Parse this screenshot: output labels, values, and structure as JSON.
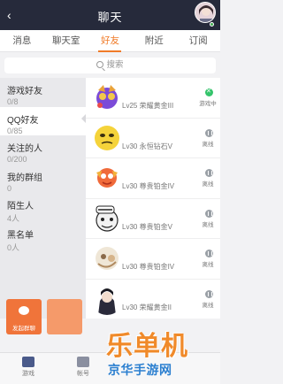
{
  "header": {
    "title": "聊天",
    "back_glyph": "‹"
  },
  "tabs": [
    {
      "label": "消息"
    },
    {
      "label": "聊天室"
    },
    {
      "label": "好友",
      "active": true
    },
    {
      "label": "附近"
    },
    {
      "label": "订阅"
    }
  ],
  "search": {
    "placeholder": "搜索"
  },
  "categories": [
    {
      "name": "游戏好友",
      "count": "0/8"
    },
    {
      "name": "QQ好友",
      "count": "0/85",
      "active": true
    },
    {
      "name": "关注的人",
      "count": "0/200"
    },
    {
      "name": "我的群组",
      "count": "0"
    },
    {
      "name": "陌生人",
      "count": "4人"
    },
    {
      "name": "黑名单",
      "count": "0人"
    }
  ],
  "friends": [
    {
      "level": "Lv25 荣耀黄金III",
      "status": "游戏中",
      "online": true
    },
    {
      "level": "Lv30 永恒钻石V",
      "status": "离线",
      "online": false
    },
    {
      "level": "Lv30 尊贵铂金IV",
      "status": "离线",
      "online": false
    },
    {
      "level": "Lv30 尊贵铂金V",
      "status": "离线",
      "online": false
    },
    {
      "level": "Lv30 尊贵铂金IV",
      "status": "离线",
      "online": false
    },
    {
      "level": "Lv30 荣耀黄金II",
      "status": "离线",
      "online": false
    }
  ],
  "actions": {
    "start_group": "发起群聊"
  },
  "bottom_nav": [
    {
      "label": "游戏"
    },
    {
      "label": "帐号"
    }
  ],
  "watermark": {
    "big": "乐单机",
    "small": "京华手游网"
  },
  "colors": {
    "accent": "#f07b28",
    "header_bg": "#262a3b",
    "online": "#34c46b",
    "offline": "#9aa0a6"
  }
}
